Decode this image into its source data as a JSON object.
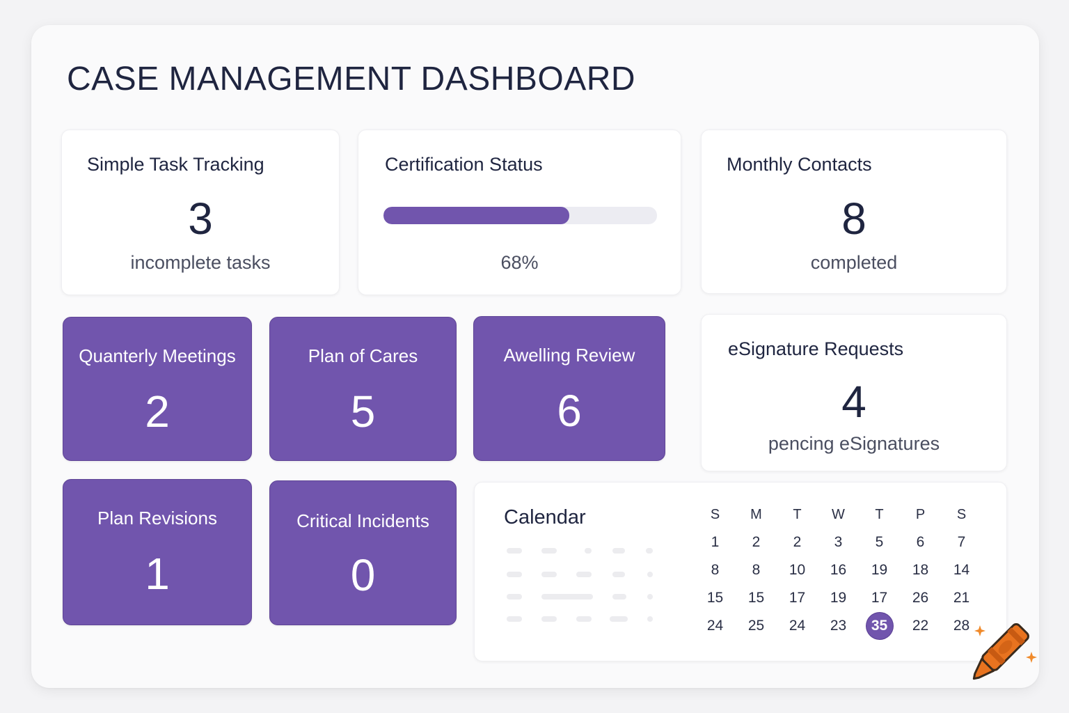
{
  "title": "CASE MANAGEMENT DASHBOARD",
  "colors": {
    "accent": "#7155ad",
    "background": "#fafafb",
    "crayon": "#e8731f"
  },
  "task_tracking": {
    "title": "Simple Task Tracking",
    "count": "3",
    "label": "incomplete tasks"
  },
  "certification": {
    "title": "Certification Status",
    "progress": 0.68,
    "percent_label": "68%"
  },
  "monthly_contacts": {
    "title": "Monthly Contacts",
    "count": "8",
    "label": "completed"
  },
  "esignature": {
    "title": "eSignature Requests",
    "count": "4",
    "label": "pencing eSignatures"
  },
  "tiles": [
    {
      "label": "Quanterly Meetings",
      "count": "2"
    },
    {
      "label": "Plan of Cares",
      "count": "5"
    },
    {
      "label": "Awelling Review",
      "count": "6"
    },
    {
      "label": "Plan Revisions",
      "count": "1"
    },
    {
      "label": "Critical Incidents",
      "count": "0"
    }
  ],
  "calendar": {
    "title": "Calendar",
    "weekdays": [
      "S",
      "M",
      "T",
      "W",
      "T",
      "P",
      "S"
    ],
    "weeks": [
      [
        "1",
        "2",
        "2",
        "3",
        "5",
        "6",
        "7"
      ],
      [
        "8",
        "8",
        "10",
        "16",
        "19",
        "18",
        "14"
      ],
      [
        "15",
        "15",
        "17",
        "19",
        "17",
        "26",
        "21"
      ],
      [
        "24",
        "25",
        "24",
        "23",
        "35",
        "22",
        "28"
      ]
    ],
    "highlighted": "35"
  },
  "decorations": {
    "crayon_icon": "crayon-icon",
    "sparkle_icon": "sparkle-icon"
  }
}
